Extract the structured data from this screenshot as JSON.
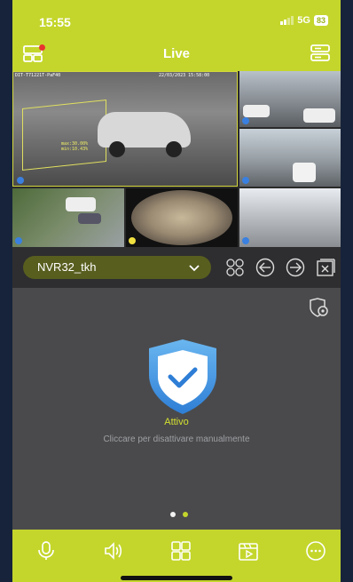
{
  "status_bar": {
    "time": "15:55",
    "network": "5G",
    "battery": "83"
  },
  "header": {
    "title": "Live",
    "left_icon": "split-screen-icon",
    "right_icon": "device-list-icon"
  },
  "cameras": {
    "main_timestamp_left": "DIT-T71221T-PaF40",
    "main_timestamp_right": "22/03/2023 15:58:00",
    "zone_line1": "max:30.00%",
    "zone_line2": "min:10.43%"
  },
  "controls": {
    "device_name": "NVR32_tkh",
    "icons": [
      "split-layout-icon",
      "prev-page-icon",
      "next-page-icon",
      "close-all-icon"
    ]
  },
  "arming": {
    "status": "Attivo",
    "hint": "Cliccare per disattivare manualmente"
  },
  "pager": {
    "pages": 2,
    "active": 1
  },
  "colors": {
    "accent": "#c4d62c",
    "active_text": "#d4e030",
    "background": "#4a4a4c"
  },
  "bottom_bar": {
    "icons": [
      "microphone-icon",
      "speaker-icon",
      "layout-grid-icon",
      "playback-icon",
      "more-icon"
    ]
  }
}
